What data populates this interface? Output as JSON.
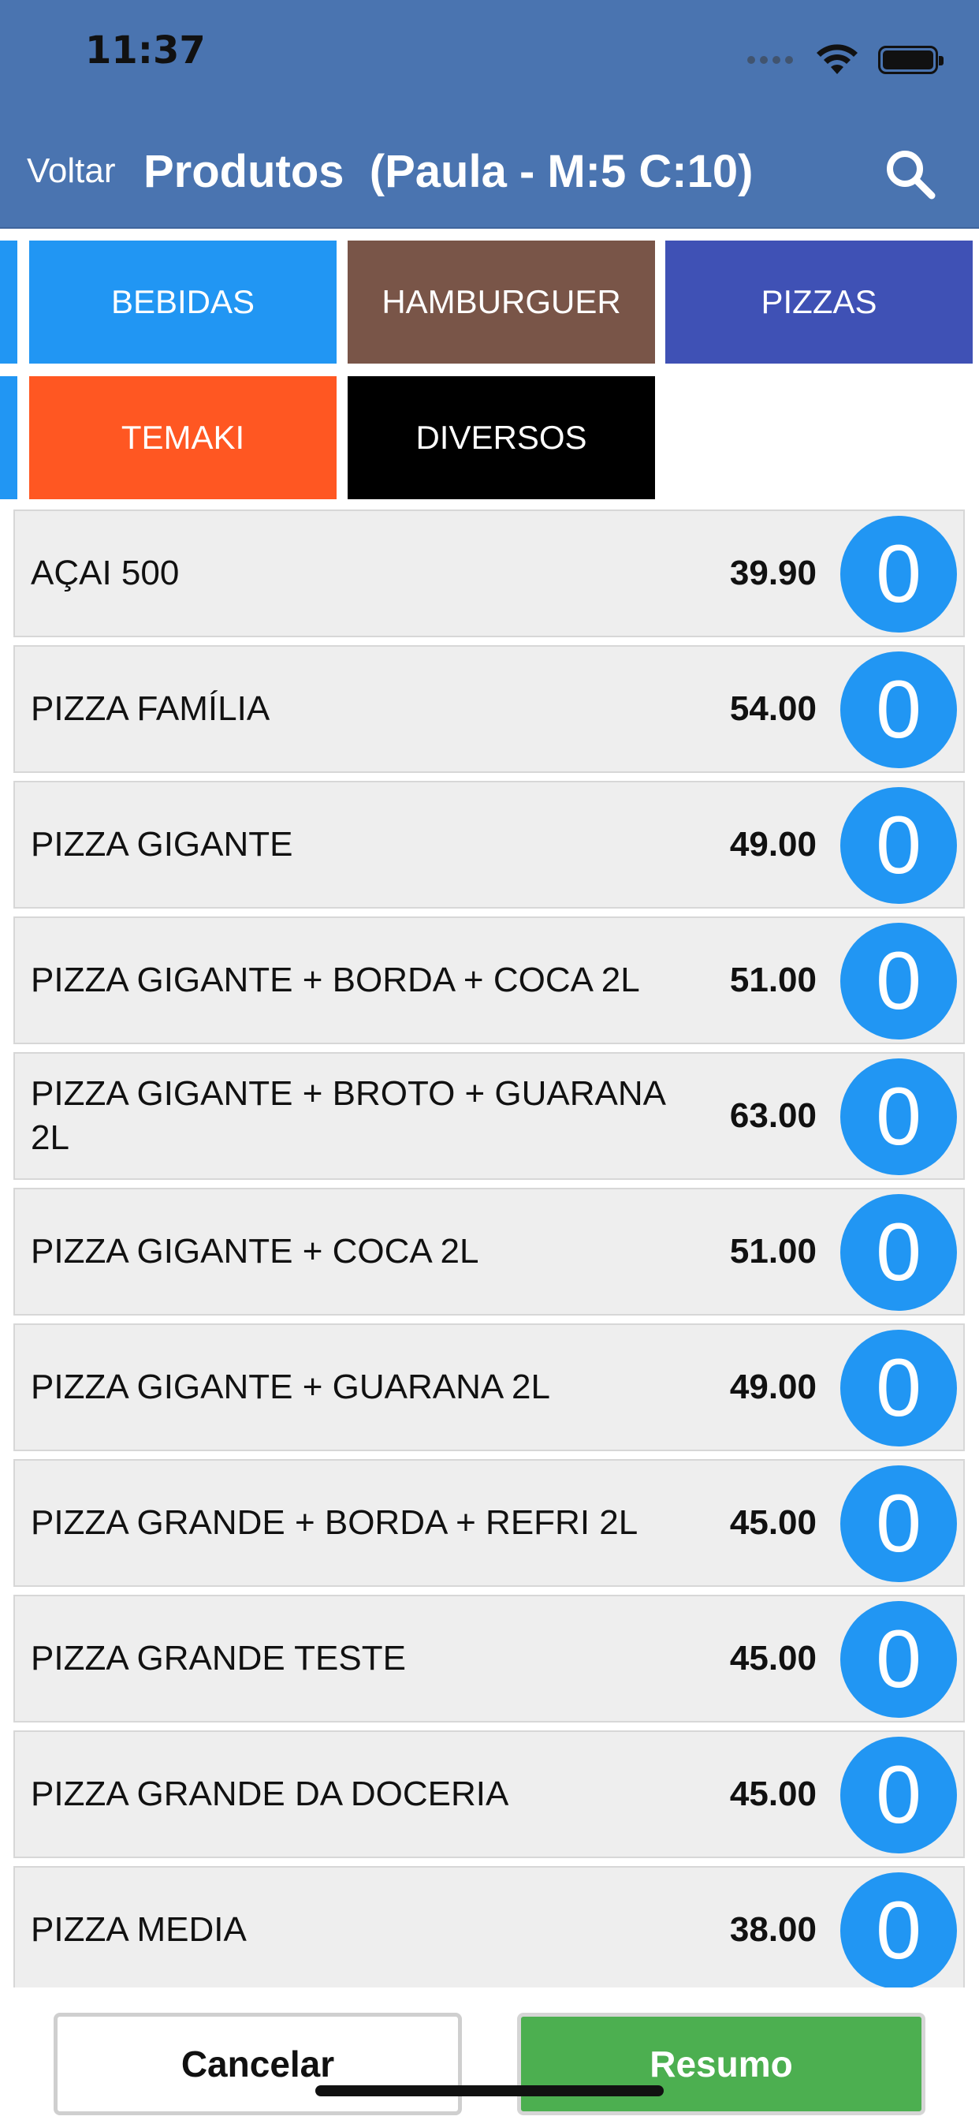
{
  "status_bar": {
    "time": "11:37"
  },
  "nav": {
    "back_label": "Voltar",
    "title": "Produtos  (Paula - M:5 C:10)"
  },
  "categories": [
    {
      "label": "BEBIDAS",
      "color": "#2196f3"
    },
    {
      "label": "HAMBURGUER",
      "color": "#795548"
    },
    {
      "label": "PIZZAS",
      "color": "#3f51b5"
    },
    {
      "label": "TEMAKI",
      "color": "#ff5722"
    },
    {
      "label": "DIVERSOS",
      "color": "#000000"
    }
  ],
  "products": [
    {
      "name": "AÇAI 500",
      "price": "39.90",
      "qty": "0"
    },
    {
      "name": "PIZZA FAMÍLIA",
      "price": "54.00",
      "qty": "0"
    },
    {
      "name": "PIZZA GIGANTE",
      "price": "49.00",
      "qty": "0"
    },
    {
      "name": "PIZZA GIGANTE + BORDA + COCA 2L",
      "price": "51.00",
      "qty": "0"
    },
    {
      "name": "PIZZA GIGANTE + BROTO + GUARANA 2L",
      "price": "63.00",
      "qty": "0"
    },
    {
      "name": "PIZZA GIGANTE + COCA 2L",
      "price": "51.00",
      "qty": "0"
    },
    {
      "name": "PIZZA GIGANTE + GUARANA 2L",
      "price": "49.00",
      "qty": "0"
    },
    {
      "name": "PIZZA GRANDE + BORDA + REFRI 2L",
      "price": "45.00",
      "qty": "0"
    },
    {
      "name": "PIZZA GRANDE TESTE",
      "price": "45.00",
      "qty": "0"
    },
    {
      "name": "PIZZA GRANDE DA DOCERIA",
      "price": "45.00",
      "qty": "0"
    },
    {
      "name": "PIZZA MEDIA",
      "price": "38.00",
      "qty": "0"
    }
  ],
  "footer": {
    "cancel_label": "Cancelar",
    "summary_label": "Resumo"
  },
  "colors": {
    "header": "#4a74b0",
    "accent": "#2196f3",
    "summary_button": "#4caf50"
  }
}
